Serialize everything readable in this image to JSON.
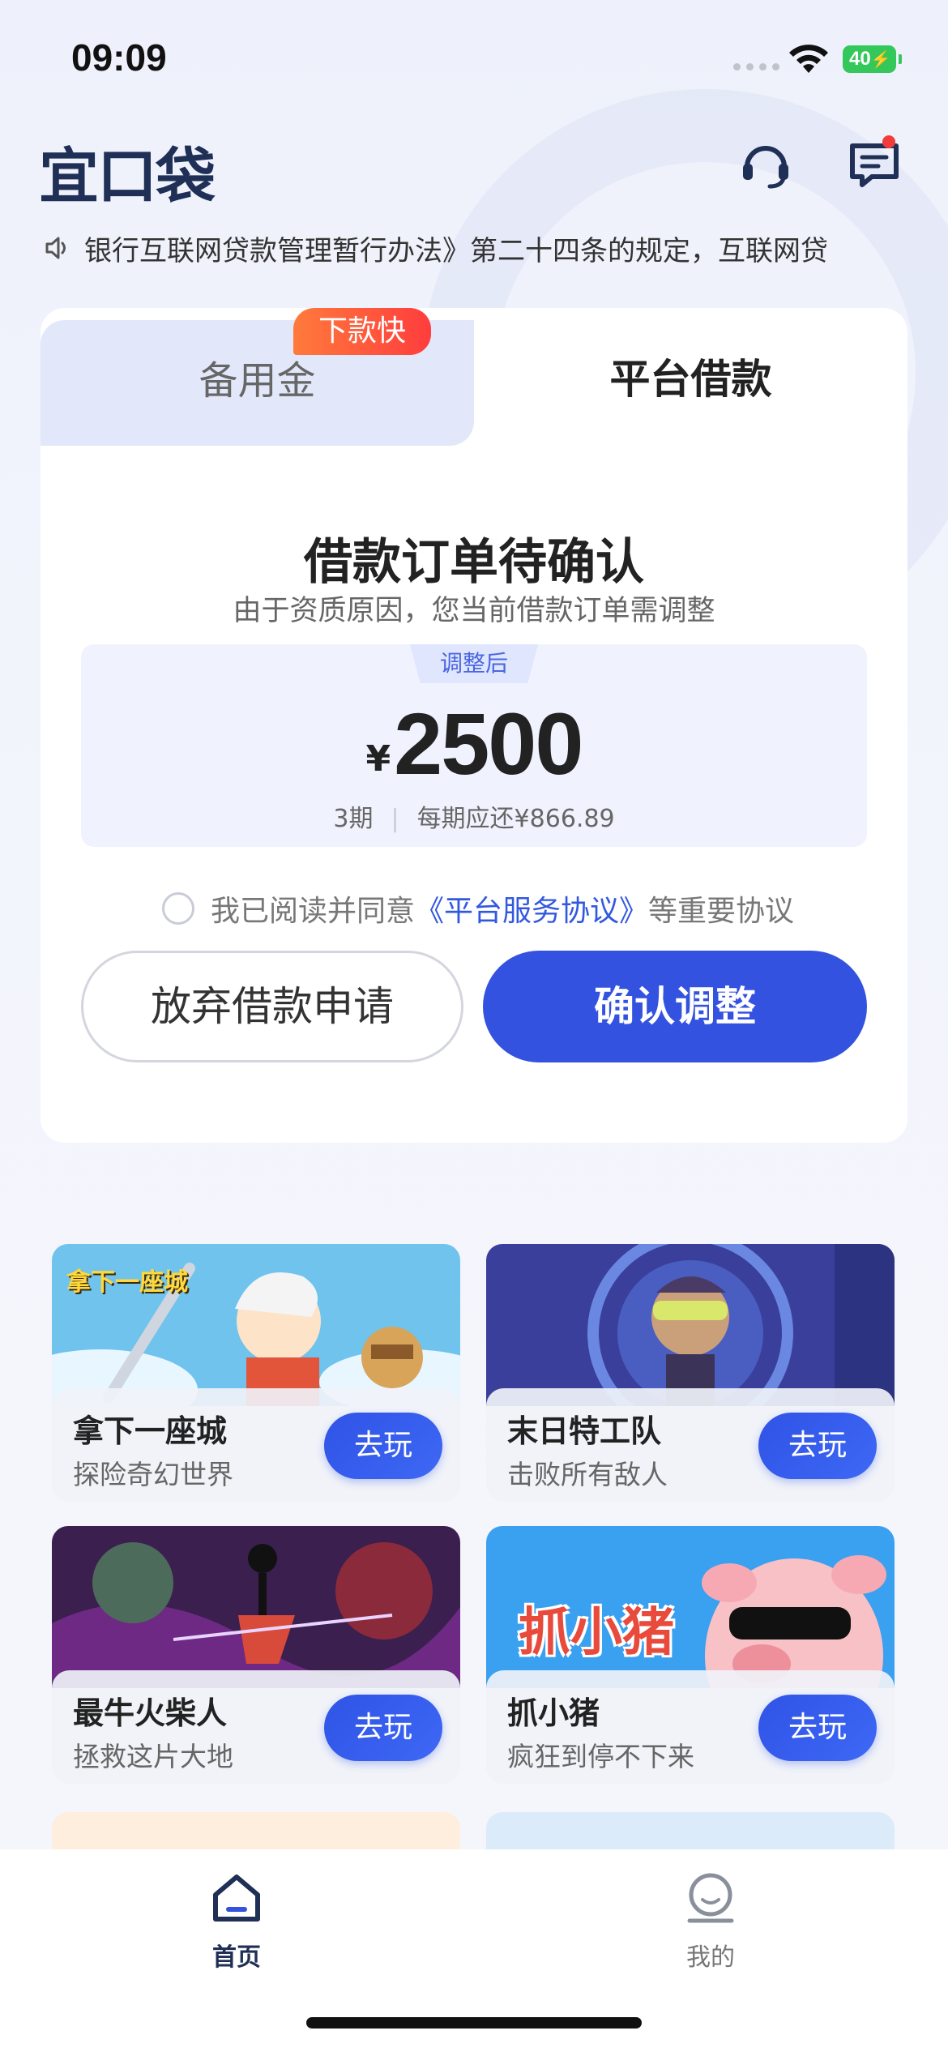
{
  "status_bar": {
    "time": "09:09",
    "battery": "40"
  },
  "header": {
    "logo": "宜口袋",
    "icons": [
      "headset-icon",
      "message-icon"
    ]
  },
  "notice": {
    "icon": "speaker-icon",
    "text": "银行互联网贷款管理暂行办法》第二十四条的规定，互联网贷"
  },
  "loan_card": {
    "tabs": [
      {
        "label": "备用金",
        "badge": "下款快",
        "active": false
      },
      {
        "label": "平台借款",
        "active": true
      }
    ],
    "title": "借款订单待确认",
    "subtitle": "由于资质原因，您当前借款订单需调整",
    "adjust_tag": "调整后",
    "currency": "¥",
    "amount": "2500",
    "periods": "3期",
    "per_period": "每期应还¥866.89",
    "agree_prefix": "我已阅读并同意",
    "agree_link": "《平台服务协议》",
    "agree_suffix": "等重要协议",
    "abandon_label": "放弃借款申请",
    "confirm_label": "确认调整"
  },
  "games": [
    {
      "name": "拿下一座城",
      "desc": "探险奇幻世界",
      "art_title": "拿下一座城",
      "play": "去玩"
    },
    {
      "name": "末日特工队",
      "desc": "击败所有敌人",
      "play": "去玩"
    },
    {
      "name": "最牛火柴人",
      "desc": "拯救这片大地",
      "play": "去玩"
    },
    {
      "name": "抓小猪",
      "desc": "疯狂到停不下来",
      "art_title": "抓小猪",
      "play": "去玩"
    }
  ],
  "tabbar": {
    "items": [
      {
        "label": "首页",
        "icon": "home-icon",
        "active": true
      },
      {
        "label": "我的",
        "icon": "profile-icon",
        "active": false
      }
    ]
  },
  "colors": {
    "primary": "#3352e0",
    "badge": "#ff4a3d",
    "logo": "#1f2f56"
  }
}
